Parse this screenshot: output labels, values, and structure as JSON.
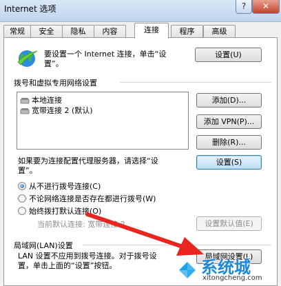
{
  "window": {
    "title": "Internet 选项",
    "help_label": "?",
    "close_label": "✕"
  },
  "tabs": [
    {
      "label": "常规"
    },
    {
      "label": "安全"
    },
    {
      "label": "隐私"
    },
    {
      "label": "内容"
    },
    {
      "label": "连接"
    },
    {
      "label": "程序"
    },
    {
      "label": "高级"
    }
  ],
  "setup": {
    "text_line1": "要设置一个 Internet 连接，单击“设",
    "text_line2": "置”。",
    "button_label": "设置(U)"
  },
  "dialup": {
    "group_title": "拨号和虚拟专用网络设置",
    "list_items": [
      "本地连接",
      "宽带连接 2 (默认)"
    ],
    "add_label": "添加(D)...",
    "add_vpn_label": "添加 VPN(P)...",
    "delete_label": "删除(R)...",
    "proxy_text_line1": "如果要为连接配置代理服务器，请选择“设",
    "proxy_text_line2": "置”。",
    "settings_label": "设置(S)",
    "options": [
      {
        "label": "从不进行拨号连接(C)",
        "selected": true
      },
      {
        "label": "不论网络连接是否存在都进行拨号(W)",
        "selected": false
      },
      {
        "label": "始终拨打默认连接(O)",
        "selected": false
      }
    ],
    "current_default_label": "当前默认连接:",
    "current_default_value": "宽带连接 2",
    "set_default_label": "设置默认值(E)"
  },
  "lan": {
    "group_title": "局域网(LAN)设置",
    "text_line1": "LAN 设置不应用到拨号连接。对于拨号设",
    "text_line2": "置，单击上面的“设置”按钮。",
    "button_label": "局域网设置(L)"
  },
  "watermark": {
    "name": "系统城",
    "url": "xitongcheng.com"
  },
  "colors": {
    "arrow": "#e8251f",
    "accent": "#3c7fb1"
  }
}
